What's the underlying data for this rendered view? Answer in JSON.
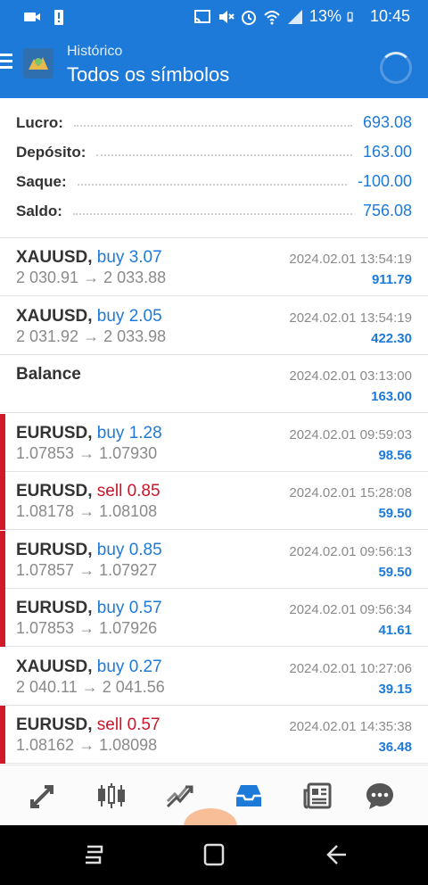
{
  "status_bar": {
    "battery": "13%",
    "time": "10:45"
  },
  "header": {
    "subtitle": "Histórico",
    "title": "Todos os símbolos"
  },
  "summary": [
    {
      "label": "Lucro:",
      "value": "693.08"
    },
    {
      "label": "Depósito:",
      "value": "163.00"
    },
    {
      "label": "Saque:",
      "value": "-100.00"
    },
    {
      "label": "Saldo:",
      "value": "756.08"
    }
  ],
  "deals": [
    {
      "symbol": "XAUUSD,",
      "op": "buy 3.07",
      "side": "buy",
      "prices": "2 030.91 → 2 033.88",
      "time": "2024.02.01 13:54:19",
      "profit": "911.79",
      "marker": false
    },
    {
      "symbol": "XAUUSD,",
      "op": "buy 2.05",
      "side": "buy",
      "prices": "2 031.92 → 2 033.98",
      "time": "2024.02.01 13:54:19",
      "profit": "422.30",
      "marker": false
    },
    {
      "symbol": "Balance",
      "op": "",
      "side": "",
      "prices": "",
      "time": "2024.02.01 03:13:00",
      "profit": "163.00",
      "marker": false
    },
    {
      "symbol": "EURUSD,",
      "op": "buy 1.28",
      "side": "buy",
      "prices": "1.07853 → 1.07930",
      "time": "2024.02.01 09:59:03",
      "profit": "98.56",
      "marker": true
    },
    {
      "symbol": "EURUSD,",
      "op": "sell 0.85",
      "side": "sell",
      "prices": "1.08178 → 1.08108",
      "time": "2024.02.01 15:28:08",
      "profit": "59.50",
      "marker": true
    },
    {
      "symbol": "EURUSD,",
      "op": "buy 0.85",
      "side": "buy",
      "prices": "1.07857 → 1.07927",
      "time": "2024.02.01 09:56:13",
      "profit": "59.50",
      "marker": true
    },
    {
      "symbol": "EURUSD,",
      "op": "buy 0.57",
      "side": "buy",
      "prices": "1.07853 → 1.07926",
      "time": "2024.02.01 09:56:34",
      "profit": "41.61",
      "marker": true
    },
    {
      "symbol": "XAUUSD,",
      "op": "buy 0.27",
      "side": "buy",
      "prices": "2 040.11 → 2 041.56",
      "time": "2024.02.01 10:27:06",
      "profit": "39.15",
      "marker": false
    },
    {
      "symbol": "EURUSD,",
      "op": "sell 0.57",
      "side": "sell",
      "prices": "1.08162 → 1.08098",
      "time": "2024.02.01 14:35:38",
      "profit": "36.48",
      "marker": true
    }
  ],
  "bottom_nav": [
    {
      "name": "quotes-icon"
    },
    {
      "name": "chart-icon"
    },
    {
      "name": "trade-icon"
    },
    {
      "name": "history-icon",
      "active": true
    },
    {
      "name": "news-icon"
    },
    {
      "name": "chat-icon"
    }
  ],
  "colors": {
    "brand": "#1e7ad8",
    "sell": "#c8162a",
    "marker": "#d01a2a"
  }
}
